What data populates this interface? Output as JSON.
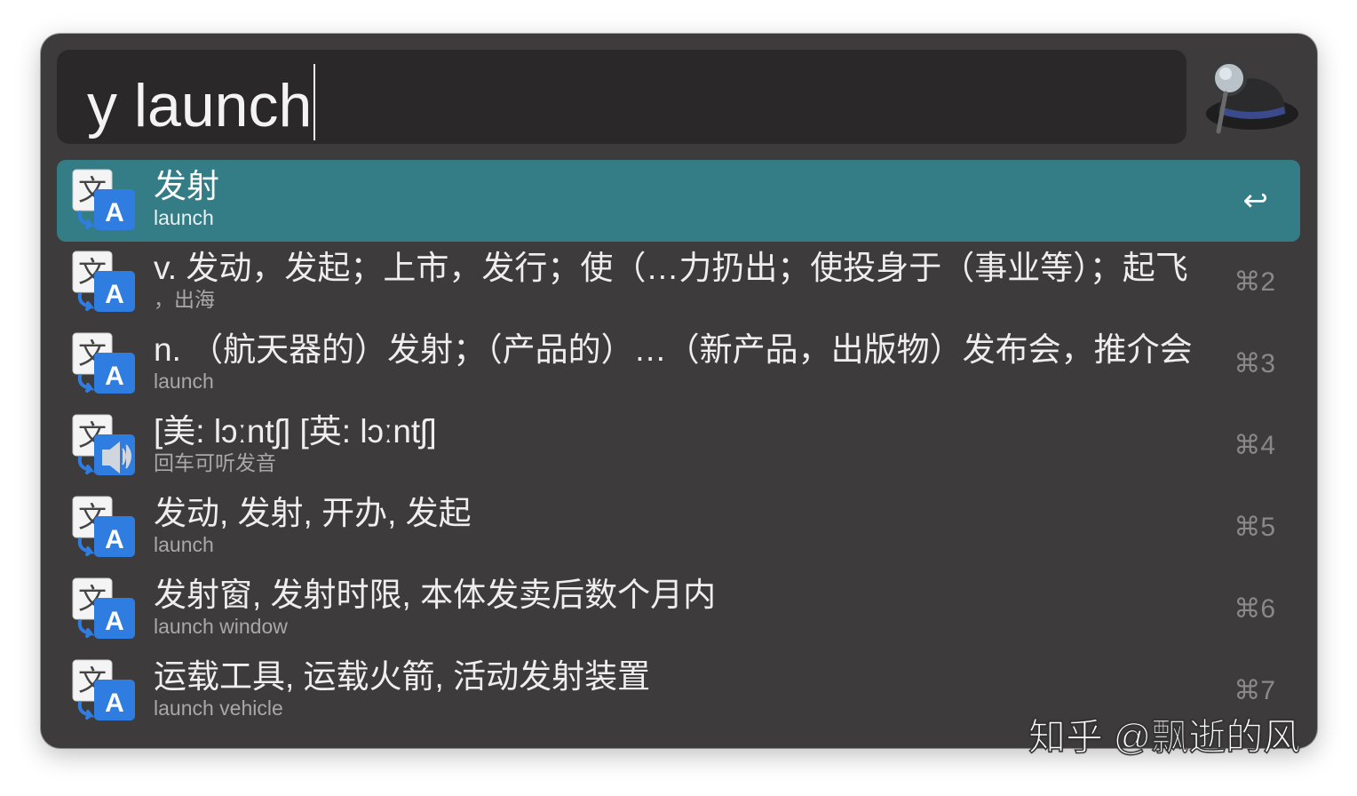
{
  "search": {
    "query": "y launch"
  },
  "results": [
    {
      "title": "发射",
      "subtitle": "launch",
      "shortcut": "↩",
      "icon": "translate-icon",
      "selected": true
    },
    {
      "title": "v. 发动，发起；上市，发行；使（…力扔出；使投身于（事业等）；起飞",
      "subtitle": "，出海",
      "shortcut": "⌘2",
      "icon": "translate-icon",
      "selected": false
    },
    {
      "title": "n. （航天器的）发射；（产品的）…（新产品，出版物）发布会，推介会",
      "subtitle": "launch",
      "shortcut": "⌘3",
      "icon": "translate-icon",
      "selected": false
    },
    {
      "title": "[美: lɔːntʃ] [英: lɔːntʃ]",
      "subtitle": "回车可听发音",
      "shortcut": "⌘4",
      "icon": "translate-speaker-icon",
      "selected": false
    },
    {
      "title": "发动, 发射, 开办, 发起",
      "subtitle": "launch",
      "shortcut": "⌘5",
      "icon": "translate-icon",
      "selected": false
    },
    {
      "title": "发射窗, 发射时限, 本体发卖后数个月内",
      "subtitle": "launch window",
      "shortcut": "⌘6",
      "icon": "translate-icon",
      "selected": false
    },
    {
      "title": "运载工具, 运载火箭, 活动发射装置",
      "subtitle": "launch vehicle",
      "shortcut": "⌘7",
      "icon": "translate-icon",
      "selected": false
    }
  ],
  "watermark": "知乎 @飘逝的风",
  "colors": {
    "window_bg": "#3d3b3b",
    "search_bg": "#2a2828",
    "selected_row": "#347d87",
    "icon_blue": "#2f7de0"
  }
}
